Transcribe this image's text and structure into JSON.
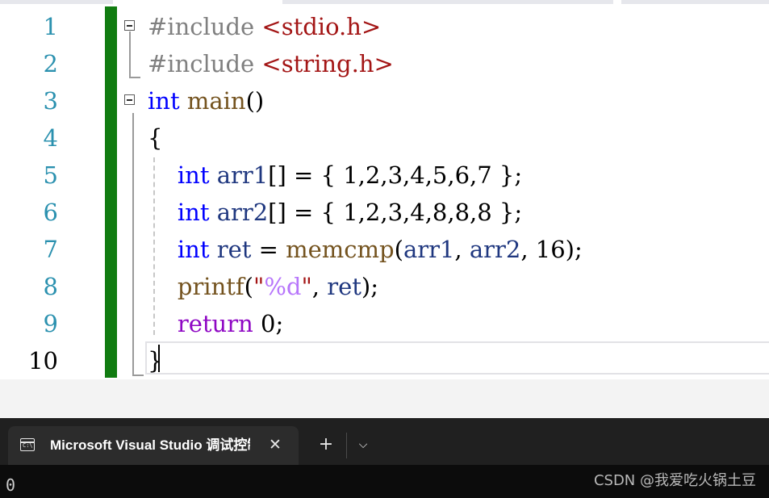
{
  "editor": {
    "line_numbers": [
      "1",
      "2",
      "3",
      "4",
      "5",
      "6",
      "7",
      "8",
      "9",
      "10"
    ],
    "lines": [
      [
        {
          "t": "#include ",
          "c": "pp"
        },
        {
          "t": "<stdio.h>",
          "c": "inc"
        }
      ],
      [
        {
          "t": "#include ",
          "c": "pp"
        },
        {
          "t": "<string.h>",
          "c": "inc"
        }
      ],
      [
        {
          "t": "int",
          "c": "kw"
        },
        {
          "t": " "
        },
        {
          "t": "main",
          "c": "fn"
        },
        {
          "t": "()"
        }
      ],
      [
        {
          "t": "{"
        }
      ],
      [
        {
          "t": "    "
        },
        {
          "t": "int",
          "c": "kw"
        },
        {
          "t": " "
        },
        {
          "t": "arr1",
          "c": "var"
        },
        {
          "t": "[] = { "
        },
        {
          "t": "1",
          "c": "num"
        },
        {
          "t": ","
        },
        {
          "t": "2",
          "c": "num"
        },
        {
          "t": ","
        },
        {
          "t": "3",
          "c": "num"
        },
        {
          "t": ","
        },
        {
          "t": "4",
          "c": "num"
        },
        {
          "t": ","
        },
        {
          "t": "5",
          "c": "num"
        },
        {
          "t": ","
        },
        {
          "t": "6",
          "c": "num"
        },
        {
          "t": ","
        },
        {
          "t": "7",
          "c": "num"
        },
        {
          "t": " };"
        }
      ],
      [
        {
          "t": "    "
        },
        {
          "t": "int",
          "c": "kw"
        },
        {
          "t": " "
        },
        {
          "t": "arr2",
          "c": "var"
        },
        {
          "t": "[] = { "
        },
        {
          "t": "1",
          "c": "num"
        },
        {
          "t": ","
        },
        {
          "t": "2",
          "c": "num"
        },
        {
          "t": ","
        },
        {
          "t": "3",
          "c": "num"
        },
        {
          "t": ","
        },
        {
          "t": "4",
          "c": "num"
        },
        {
          "t": ","
        },
        {
          "t": "8",
          "c": "num"
        },
        {
          "t": ","
        },
        {
          "t": "8",
          "c": "num"
        },
        {
          "t": ","
        },
        {
          "t": "8",
          "c": "num"
        },
        {
          "t": " };"
        }
      ],
      [
        {
          "t": "    "
        },
        {
          "t": "int",
          "c": "kw"
        },
        {
          "t": " "
        },
        {
          "t": "ret",
          "c": "var"
        },
        {
          "t": " = "
        },
        {
          "t": "memcmp",
          "c": "fn"
        },
        {
          "t": "("
        },
        {
          "t": "arr1",
          "c": "var"
        },
        {
          "t": ", "
        },
        {
          "t": "arr2",
          "c": "var"
        },
        {
          "t": ", "
        },
        {
          "t": "16",
          "c": "num"
        },
        {
          "t": ");"
        }
      ],
      [
        {
          "t": "    "
        },
        {
          "t": "printf",
          "c": "fn"
        },
        {
          "t": "("
        },
        {
          "t": "\"",
          "c": "str"
        },
        {
          "t": "%d",
          "c": "esc"
        },
        {
          "t": "\"",
          "c": "str"
        },
        {
          "t": ", "
        },
        {
          "t": "ret",
          "c": "var"
        },
        {
          "t": ");"
        }
      ],
      [
        {
          "t": "    "
        },
        {
          "t": "return",
          "c": "kwc"
        },
        {
          "t": " "
        },
        {
          "t": "0",
          "c": "num"
        },
        {
          "t": ";"
        }
      ],
      [
        {
          "t": "}"
        }
      ]
    ]
  },
  "terminal": {
    "tab_title": "Microsoft Visual Studio 调试控制台",
    "tab_icon": "console-icon",
    "close_icon": "close-icon",
    "close_glyph": "✕",
    "new_tab_icon": "plus-icon",
    "new_tab_glyph": "+",
    "dropdown_icon": "chevron-down-icon",
    "dropdown_glyph": "⌵",
    "output": "0",
    "watermark": "CSDN @我爱吃火锅土豆"
  },
  "colors": {
    "keyword": "#0000ff",
    "control_keyword": "#8f08c4",
    "preprocessor": "#808080",
    "include_path": "#a31515",
    "variable": "#1f377f",
    "function": "#74531f",
    "format_specifier": "#b776fb",
    "line_number": "#2b91af",
    "change_bar": "#117c11",
    "terminal_bg": "#0c0c0c"
  }
}
